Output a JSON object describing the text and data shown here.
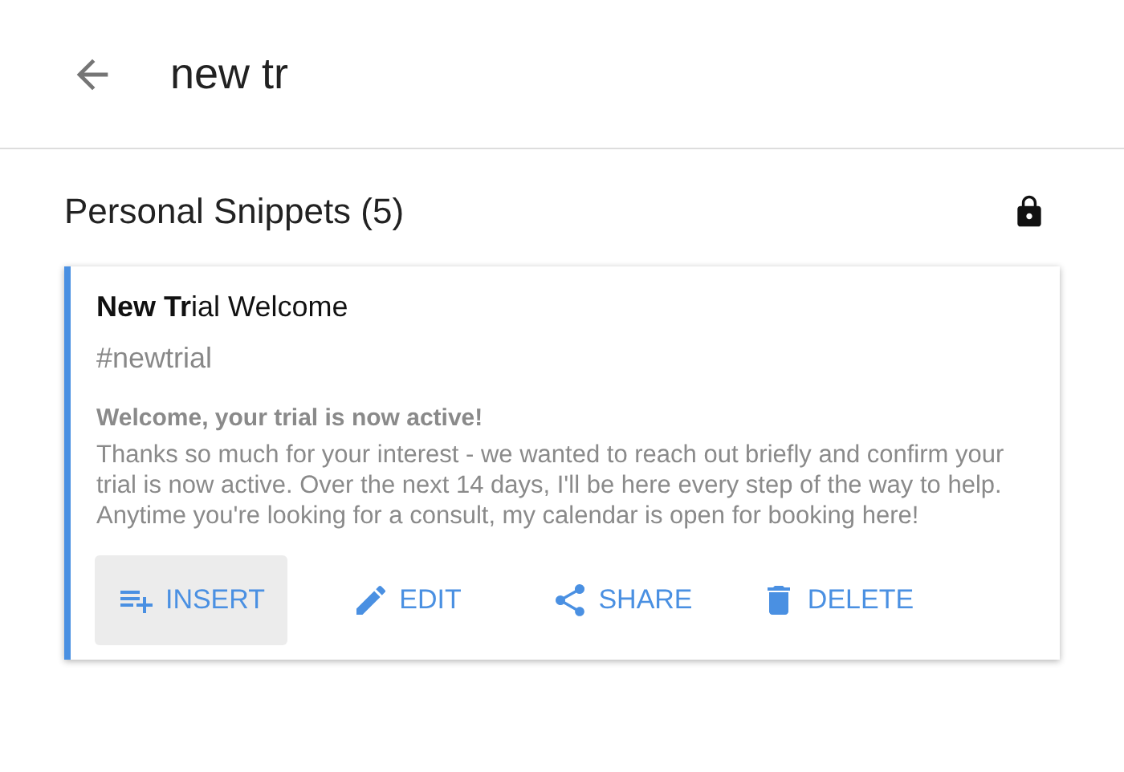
{
  "search": {
    "value": "new tr"
  },
  "section": {
    "title": "Personal Snippets (5)",
    "locked": true
  },
  "snippets": [
    {
      "title": "**New Tr**ial Welcome",
      "tag": "#newtrial",
      "subject": "Welcome, your trial is now active!",
      "body": "Thanks so much for your interest - we wanted to reach out briefly and confirm your trial is now active. Over the next 14 days, I'll be here every step of the way to help. Anytime you're looking for a consult, my calendar is open for booking here!",
      "actions": [
        {
          "kind": "insert",
          "label": "INSERT",
          "selected": true
        },
        {
          "kind": "edit",
          "label": "EDIT",
          "selected": false
        },
        {
          "kind": "share",
          "label": "SHARE",
          "selected": false
        },
        {
          "kind": "delete",
          "label": "DELETE",
          "selected": false
        }
      ]
    }
  ]
}
